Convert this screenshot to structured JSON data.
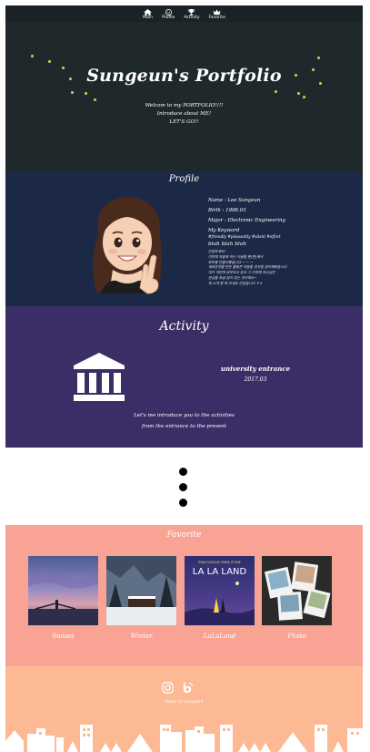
{
  "nav": {
    "items": [
      {
        "label": "Main",
        "icon": "home-icon"
      },
      {
        "label": "Profile",
        "icon": "face-icon"
      },
      {
        "label": "Activity",
        "icon": "trophy-icon"
      },
      {
        "label": "Favorite",
        "icon": "crown-icon"
      }
    ]
  },
  "hero": {
    "title": "Sungeun's Portfolio",
    "line1": "Welcom to my PORTFOLIO!!!!",
    "line2": "Introduce about ME!",
    "line3": "LET'S GO!!"
  },
  "profile": {
    "title": "Profile",
    "name": "Name : Lee Sungeun",
    "birth": "Birth : 1998.03",
    "major": "Major : Electronic Engineering",
    "keyword_title": "My Keyword",
    "keywords": "#friendly #pleasantly #silent #effort",
    "bio_title": "blah blah blah",
    "bio_lines": [
      "안녕하세요!",
      "이번에 처음에 하는 이글을 통(한)해서",
      "포트폴 만들어봤습니다 ~ ~ ~",
      "새로운것을 만든 활동은 처음을 것처럼 정리해봤습니다",
      "내가 이번에 공부하고 있고 그 이후에 하고싶은",
      "관심을 조금 많이 있는 것이에요~",
      "제 소개 잘 봐 주세요 반갑습니다 ㅎㅎ"
    ]
  },
  "activity": {
    "title": "Activity",
    "entry_name": "university entrance",
    "entry_date": "2017.03",
    "desc_line1": "Let's me introduce you to the activities",
    "desc_line2": "from the entrance to the present"
  },
  "favorite": {
    "title": "Favorite",
    "items": [
      {
        "label": "Sunset"
      },
      {
        "label": "Winter"
      },
      {
        "label": "LaLaLand",
        "poster_top": "RYAN GOSLING   EMMA STONE",
        "poster_title": "LA LA LAND"
      },
      {
        "label": "Photo"
      }
    ]
  },
  "footer": {
    "made_by": "made by Sungeun",
    "icons": [
      "instagram-icon",
      "blog-icon"
    ]
  },
  "colors": {
    "nav_bg": "#1b2226",
    "hero_bg": "#1f292c",
    "profile_bg": "#1c2946",
    "activity_bg": "#3b2e66",
    "favorite_bg": "#f9a394",
    "footer_bg": "#fdb894"
  }
}
